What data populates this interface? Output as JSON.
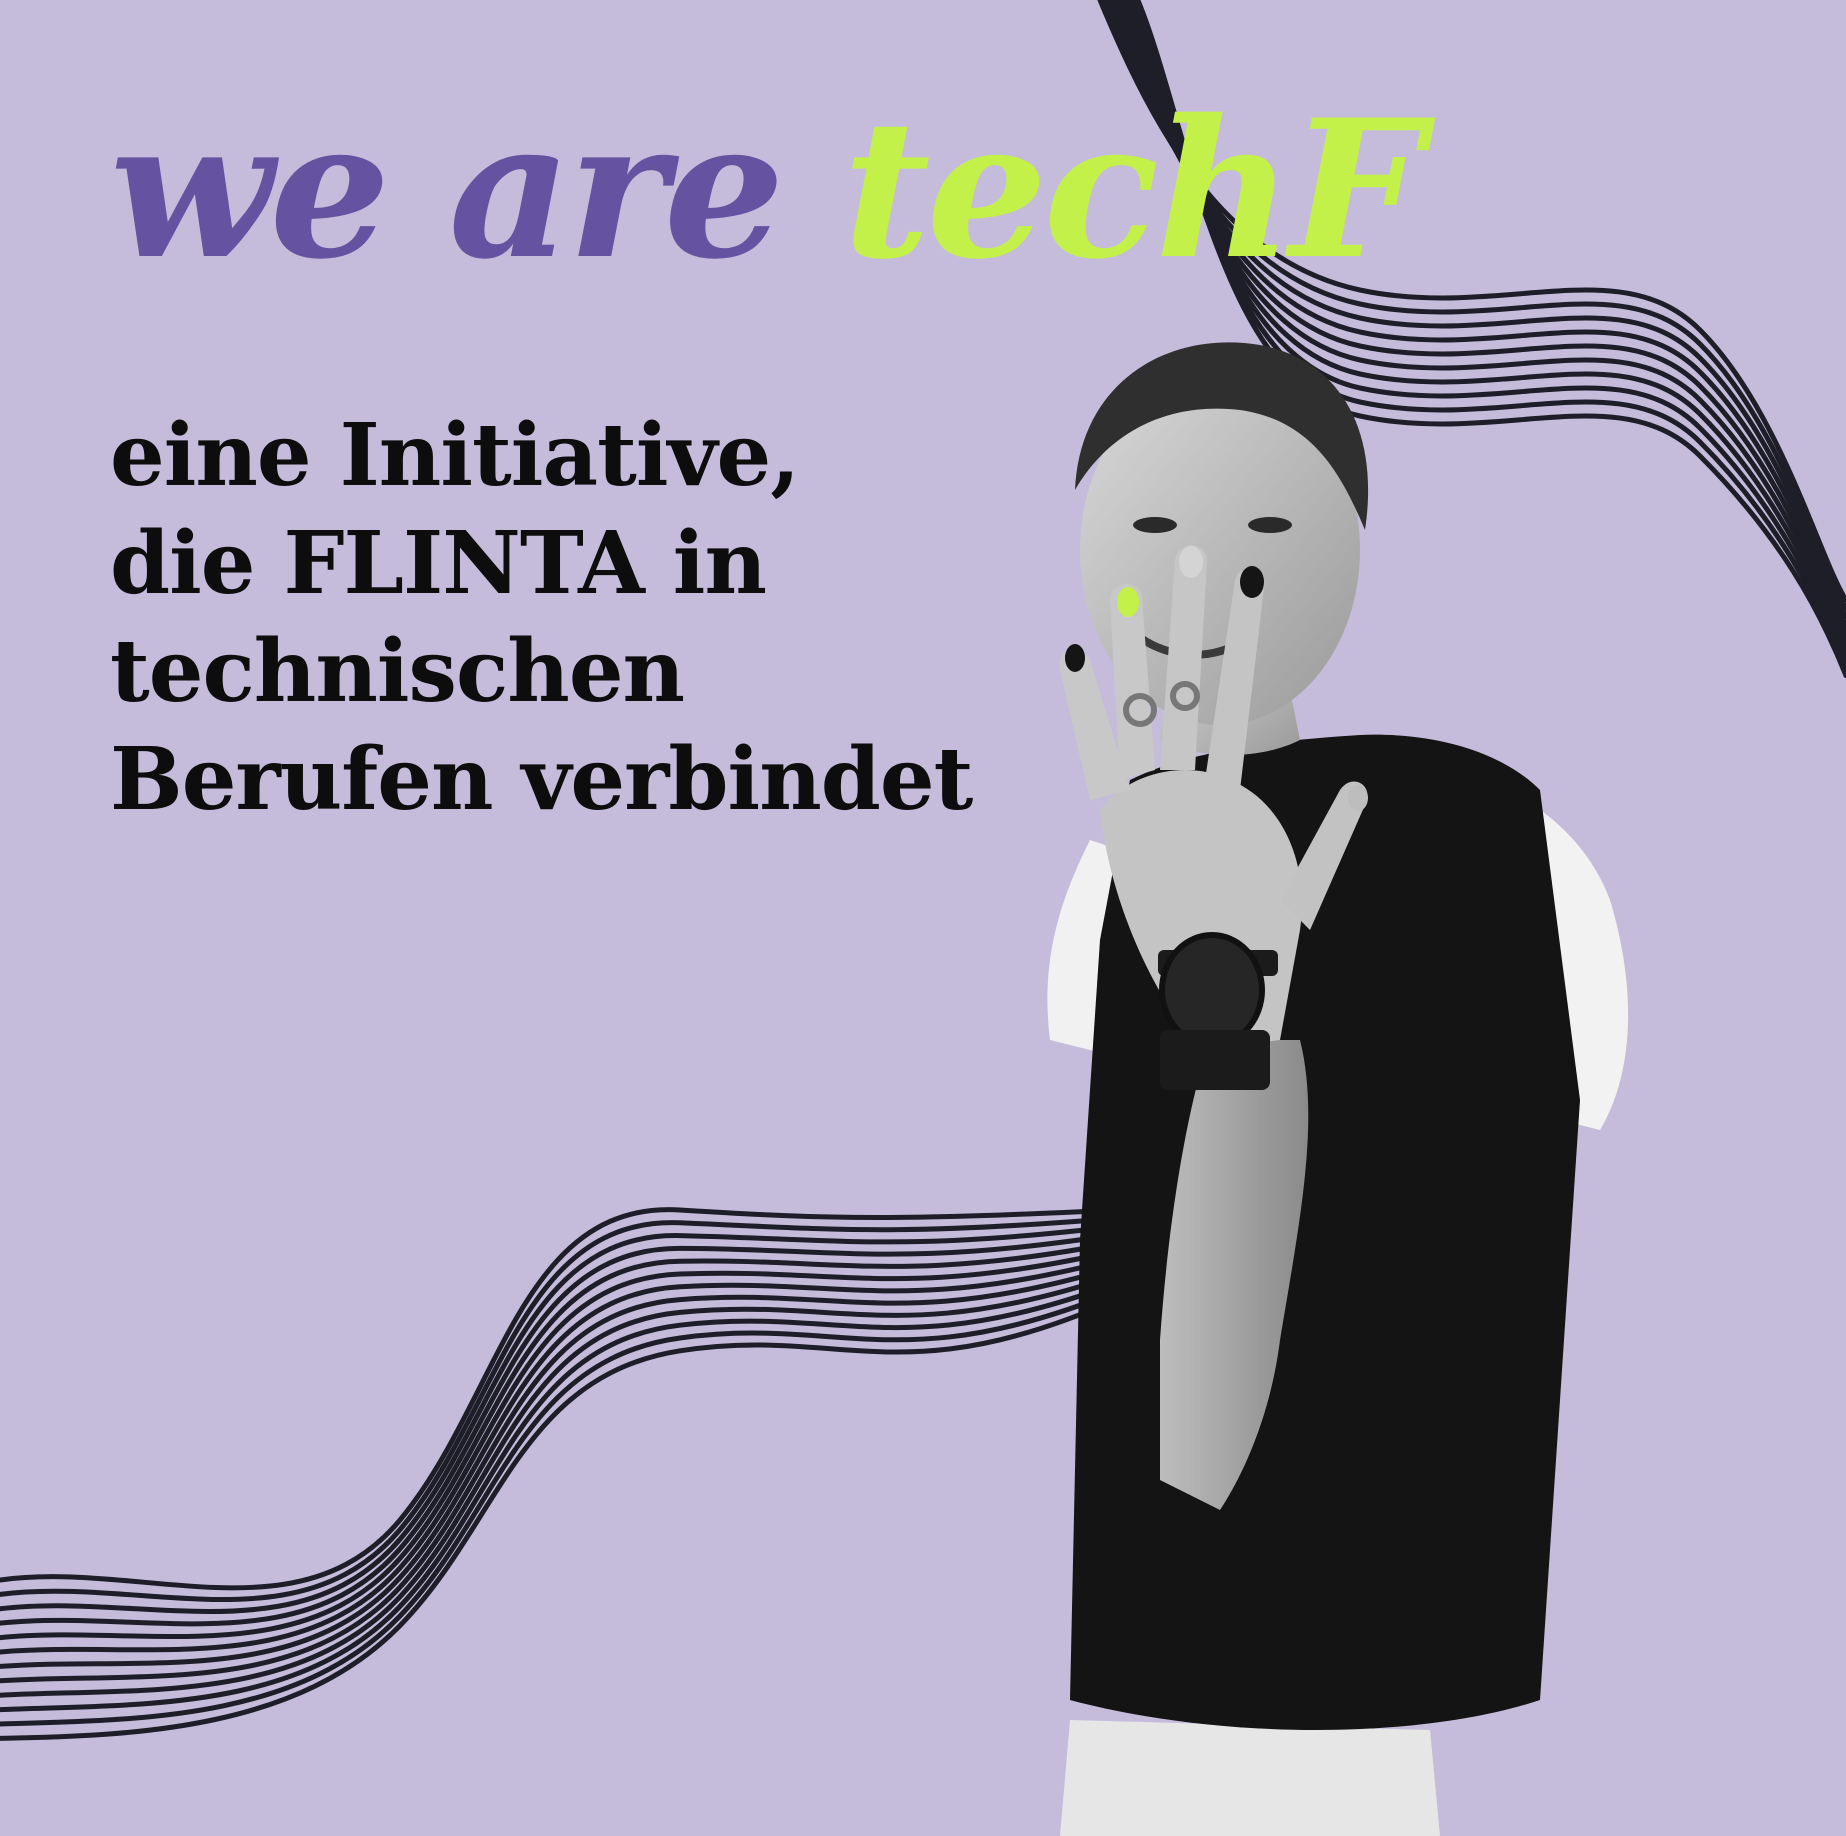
{
  "poster": {
    "headline": {
      "part1": "we are",
      "part2": "techF"
    },
    "subline": [
      "eine Initiative,",
      "die FLINTA in",
      "technischen",
      "Berufen verbindet"
    ]
  },
  "colors": {
    "background": "#c5bcdc",
    "headline_purple": "#6552a0",
    "headline_lime": "#c4f04a",
    "text_dark": "#0d0d0d",
    "wave_lines": "#1e1e28"
  },
  "icons": {
    "decoration": "wave-lines",
    "photo": "person-showing-painted-nails"
  }
}
